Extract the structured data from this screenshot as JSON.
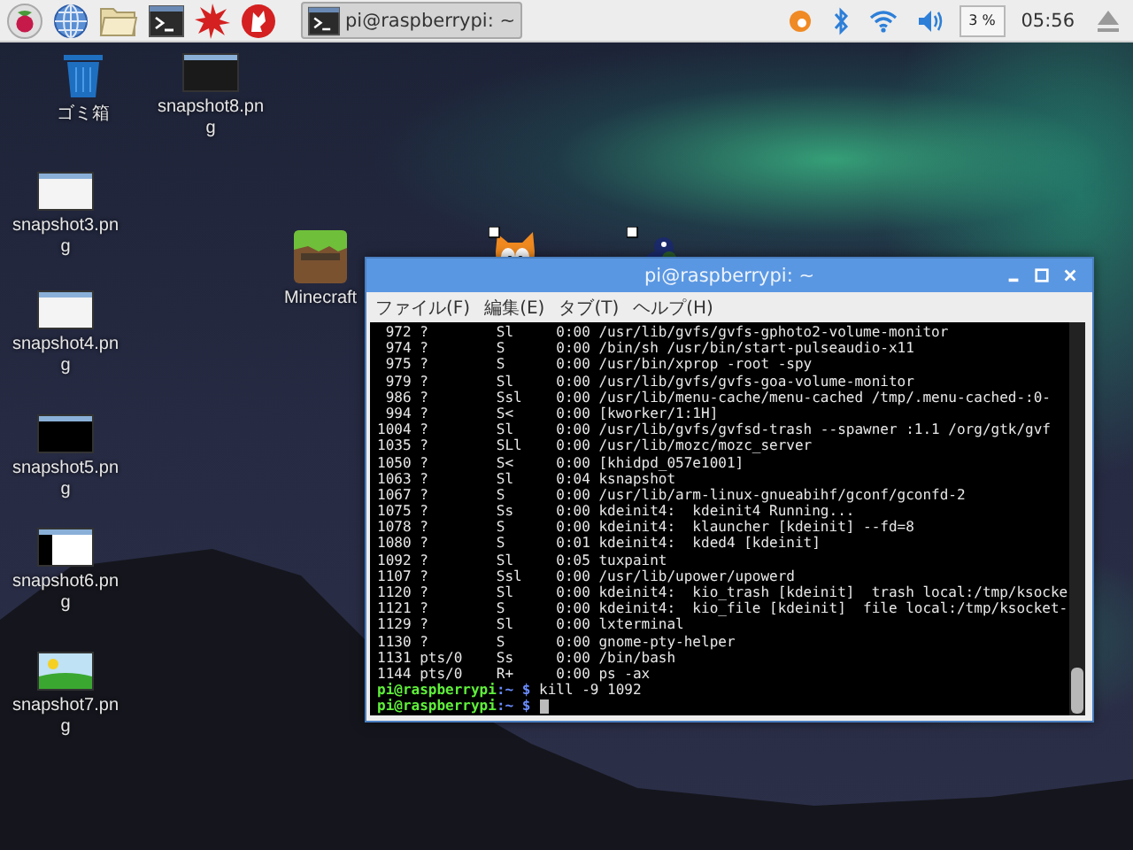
{
  "taskbar": {
    "task": {
      "title": "pi@raspberrypi: ~",
      "selected": true
    },
    "cpu": "3 %",
    "clock": "05:56"
  },
  "desktop_icons": [
    {
      "kind": "trash",
      "label": "ゴミ箱"
    },
    {
      "kind": "dark",
      "label": "snapshot8.png"
    },
    {
      "kind": "light",
      "label": "snapshot3.png"
    },
    {
      "kind": "light",
      "label": "snapshot4.png"
    },
    {
      "kind": "black",
      "label": "snapshot5.png"
    },
    {
      "kind": "split",
      "label": "snapshot6.png"
    },
    {
      "kind": "landscape",
      "label": "snapshot7.png"
    },
    {
      "kind": "minecraft",
      "label": "Minecraft"
    },
    {
      "kind": "cat"
    },
    {
      "kind": "snake"
    }
  ],
  "terminal": {
    "title": "pi@raspberrypi: ~",
    "menu": [
      "ファイル(F)",
      "編集(E)",
      "タブ(T)",
      "ヘルプ(H)"
    ],
    "rows": [
      {
        "pid": "972",
        "tty": "?",
        "stat": "Sl",
        "time": "0:00",
        "command": "/usr/lib/gvfs/gvfs-gphoto2-volume-monitor"
      },
      {
        "pid": "974",
        "tty": "?",
        "stat": "S",
        "time": "0:00",
        "command": "/bin/sh /usr/bin/start-pulseaudio-x11"
      },
      {
        "pid": "975",
        "tty": "?",
        "stat": "S",
        "time": "0:00",
        "command": "/usr/bin/xprop -root -spy"
      },
      {
        "pid": "979",
        "tty": "?",
        "stat": "Sl",
        "time": "0:00",
        "command": "/usr/lib/gvfs/gvfs-goa-volume-monitor"
      },
      {
        "pid": "986",
        "tty": "?",
        "stat": "Ssl",
        "time": "0:00",
        "command": "/usr/lib/menu-cache/menu-cached /tmp/.menu-cached-:0-"
      },
      {
        "pid": "994",
        "tty": "?",
        "stat": "S<",
        "time": "0:00",
        "command": "[kworker/1:1H]"
      },
      {
        "pid": "1004",
        "tty": "?",
        "stat": "Sl",
        "time": "0:00",
        "command": "/usr/lib/gvfs/gvfsd-trash --spawner :1.1 /org/gtk/gvf"
      },
      {
        "pid": "1035",
        "tty": "?",
        "stat": "SLl",
        "time": "0:00",
        "command": "/usr/lib/mozc/mozc_server"
      },
      {
        "pid": "1050",
        "tty": "?",
        "stat": "S<",
        "time": "0:00",
        "command": "[khidpd_057e1001]"
      },
      {
        "pid": "1063",
        "tty": "?",
        "stat": "Sl",
        "time": "0:04",
        "command": "ksnapshot"
      },
      {
        "pid": "1067",
        "tty": "?",
        "stat": "S",
        "time": "0:00",
        "command": "/usr/lib/arm-linux-gnueabihf/gconf/gconfd-2"
      },
      {
        "pid": "1075",
        "tty": "?",
        "stat": "Ss",
        "time": "0:00",
        "command": "kdeinit4:  kdeinit4 Running..."
      },
      {
        "pid": "1078",
        "tty": "?",
        "stat": "S",
        "time": "0:00",
        "command": "kdeinit4:  klauncher [kdeinit] --fd=8"
      },
      {
        "pid": "1080",
        "tty": "?",
        "stat": "S",
        "time": "0:01",
        "command": "kdeinit4:  kded4 [kdeinit]"
      },
      {
        "pid": "1092",
        "tty": "?",
        "stat": "Sl",
        "time": "0:05",
        "command": "tuxpaint"
      },
      {
        "pid": "1107",
        "tty": "?",
        "stat": "Ssl",
        "time": "0:00",
        "command": "/usr/lib/upower/upowerd"
      },
      {
        "pid": "1120",
        "tty": "?",
        "stat": "Sl",
        "time": "0:00",
        "command": "kdeinit4:  kio_trash [kdeinit]  trash local:/tmp/ksocke"
      },
      {
        "pid": "1121",
        "tty": "?",
        "stat": "S",
        "time": "0:00",
        "command": "kdeinit4:  kio_file [kdeinit]  file local:/tmp/ksocket-"
      },
      {
        "pid": "1129",
        "tty": "?",
        "stat": "Sl",
        "time": "0:00",
        "command": "lxterminal"
      },
      {
        "pid": "1130",
        "tty": "?",
        "stat": "S",
        "time": "0:00",
        "command": "gnome-pty-helper"
      },
      {
        "pid": "1131",
        "tty": "pts/0",
        "stat": "Ss",
        "time": "0:00",
        "command": "/bin/bash"
      },
      {
        "pid": "1144",
        "tty": "pts/0",
        "stat": "R+",
        "time": "0:00",
        "command": "ps -ax"
      }
    ],
    "prompts": [
      {
        "user_host": "pi@raspberrypi",
        "path": ":~ $",
        "input": "kill -9 1092",
        "cursor": false
      },
      {
        "user_host": "pi@raspberrypi",
        "path": ":~ $",
        "cursor": true
      }
    ]
  }
}
